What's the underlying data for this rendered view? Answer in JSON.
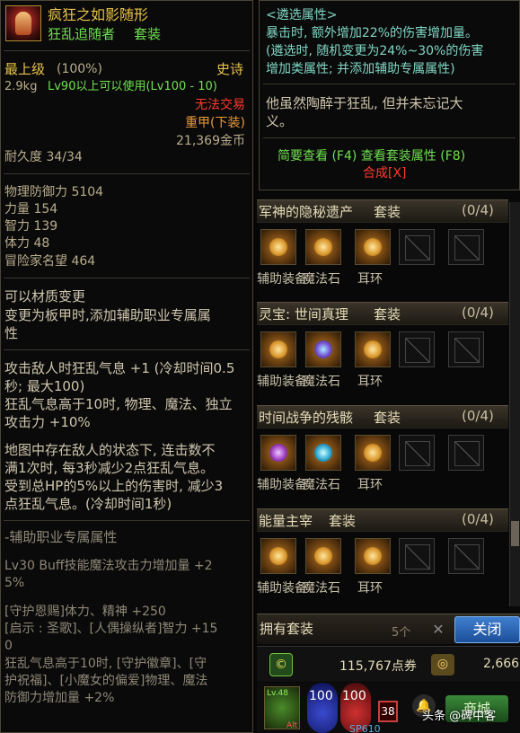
{
  "tooltip_item": {
    "name": "疯狂之如影随形",
    "subtitle": "狂乱追随者",
    "set_tag": "套装",
    "grade": "最上级",
    "grade_pct": "(100%)",
    "rarity": "史诗",
    "weight": "2.9kg",
    "level_req": "Lv90以上可以使用(Lv100 - 10)",
    "trade": "无法交易",
    "slot_type": "重甲(下装)",
    "price": "21,369金币",
    "durability": "耐久度 34/34",
    "stats": [
      "物理防御力 5104",
      "力量 154",
      "智力 139",
      "体力 48",
      "冒险家名望 464"
    ],
    "material_lines": [
      "可以材质变更",
      "变更为板甲时,添加辅助职业专属属",
      "性"
    ],
    "effect_lines": [
      "攻击敌人时狂乱气息 +1 (冷却时间0.5",
      "秒; 最大100)",
      "狂乱气息高于10时, 物理、魔法、独立",
      "攻击力 +10%"
    ],
    "effect2_lines": [
      "地图中存在敌人的状态下, 连击数不",
      "满1次时, 每3秒减少2点狂乱气息。",
      "受到总HP的5%以上的伤害时, 减少3",
      "点狂乱气息。(冷却时间1秒)"
    ],
    "support_header": "-辅助职业专属属性",
    "support_lines": [
      "Lv30 Buff技能魔法攻击力增加量 +2",
      "5%",
      "",
      "[守护恩赐]体力、精神 +250",
      "[启示 : 圣歌]、[人偶操纵者]智力 +15",
      "0",
      "狂乱气息高于10时, [守护徽章]、[守",
      "护祝福]、[小魔女的偏爱]物理、魔法",
      "防御力增加量 +2%"
    ]
  },
  "option_panel": {
    "title": "<遴选属性>",
    "lines": [
      "暴击时, 额外增加22%的伤害增加量。",
      "(遴选时, 随机变更为24%~30%的伤害",
      "增加类属性; 并添加辅助专属属性)"
    ],
    "flavor": [
      "他虽然陶醉于狂乱, 但并未忘记大",
      "义。"
    ],
    "hint": "简要查看 (F4) 查看套装属性 (F8)",
    "synth": "合成[X]"
  },
  "sets": [
    {
      "name": "军神的隐秘遗产",
      "tag": "套装",
      "count": "(0/4)",
      "labels": [
        "辅助装备",
        "魔法石",
        "耳环"
      ]
    },
    {
      "name": "灵宝: 世间真理",
      "tag": "套装",
      "count": "(0/4)",
      "labels": [
        "辅助装备",
        "魔法石",
        "耳环"
      ]
    },
    {
      "name": "时间战争的残骸",
      "tag": "套装",
      "count": "(0/4)",
      "labels": [
        "辅助装备",
        "魔法石",
        "耳环"
      ]
    },
    {
      "name": "能量主宰",
      "tag": "套装",
      "count": "(0/4)",
      "labels": [
        "辅助装备",
        "魔法石",
        "耳环"
      ]
    }
  ],
  "footer": {
    "owned_sets": "拥有套装",
    "count_label": "5个",
    "close": "关闭",
    "points": "115,767点券",
    "coins": "2,666",
    "hp": "100",
    "mp": "100",
    "level": "38",
    "lv_badge": "Lv.48",
    "alt": "Alt",
    "sp": "SP610",
    "watermark_prefix": "头条",
    "watermark_name": "@碑中客",
    "shop": "商城"
  },
  "colors": {
    "gold": "#e8c24a",
    "green": "#6fe04f",
    "red": "#ff3a2e",
    "orange": "#e89a3a",
    "text": "#cfc6ad",
    "teal": "#7fd7c4"
  }
}
